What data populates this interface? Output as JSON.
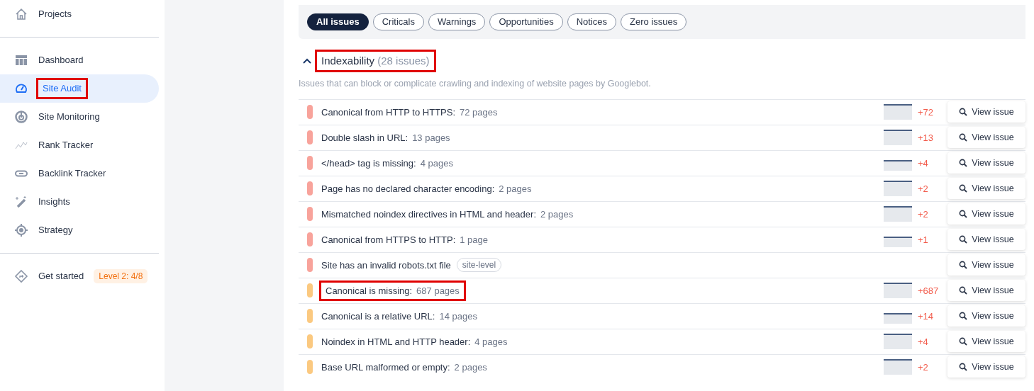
{
  "sidebar": {
    "top_items": [
      {
        "label": "Projects",
        "selected": false,
        "highlighted": false
      }
    ],
    "items": [
      {
        "label": "Dashboard",
        "selected": false,
        "highlighted": false
      },
      {
        "label": "Site Audit",
        "selected": true,
        "highlighted": true
      },
      {
        "label": "Site Monitoring",
        "selected": false,
        "highlighted": false
      },
      {
        "label": "Rank Tracker",
        "selected": false,
        "highlighted": false
      },
      {
        "label": "Backlink Tracker",
        "selected": false,
        "highlighted": false
      },
      {
        "label": "Insights",
        "selected": false,
        "highlighted": false
      },
      {
        "label": "Strategy",
        "selected": false,
        "highlighted": false
      }
    ],
    "bottom_items": [
      {
        "label": "Get started",
        "selected": false,
        "highlighted": false,
        "badge": "Level 2: 4/8"
      }
    ]
  },
  "filters": [
    {
      "label": "All issues",
      "selected": true
    },
    {
      "label": "Criticals",
      "selected": false
    },
    {
      "label": "Warnings",
      "selected": false
    },
    {
      "label": "Opportunities",
      "selected": false
    },
    {
      "label": "Notices",
      "selected": false
    },
    {
      "label": "Zero issues",
      "selected": false
    }
  ],
  "section": {
    "title": "Indexability",
    "count": "(28 issues)",
    "expanded": true,
    "highlighted": true,
    "description": "Issues that can block or complicate crawling and indexing of website pages by Googlebot.",
    "issues": [
      {
        "title": "Canonical from HTTP to HTTPS:",
        "pages": "72 pages",
        "color": "#f8a39b",
        "change": "+72",
        "button": "View issue",
        "highlighted": false
      },
      {
        "title": "Double slash in URL:",
        "pages": "13 pages",
        "color": "#f8a39b",
        "change": "+13",
        "button": "View issue",
        "highlighted": false
      },
      {
        "title": "</head> tag is missing:",
        "pages": "4 pages",
        "color": "#f8a39b",
        "change": "+4",
        "button": "View issue",
        "highlighted": false
      },
      {
        "title": "Page has no declared character encoding:",
        "pages": "2 pages",
        "color": "#f8a39b",
        "change": "+2",
        "button": "View issue",
        "highlighted": false
      },
      {
        "title": "Mismatched noindex directives in HTML and header:",
        "pages": "2 pages",
        "color": "#f8a39b",
        "change": "+2",
        "button": "View issue",
        "highlighted": false
      },
      {
        "title": "Canonical from HTTPS to HTTP:",
        "pages": "1 page",
        "color": "#f8a39b",
        "change": "+1",
        "button": "View issue",
        "highlighted": false
      },
      {
        "title": "Site has an invalid robots.txt file",
        "tag": "site-level",
        "color": "#f8a39b",
        "button": "View issue",
        "highlighted": false
      },
      {
        "title": "Canonical is missing:",
        "pages": "687 pages",
        "color": "#fbc980",
        "change": "+687",
        "button": "View issue",
        "highlighted": true
      },
      {
        "title": "Canonical is a relative URL:",
        "pages": "14 pages",
        "color": "#fbc980",
        "change": "+14",
        "button": "View issue",
        "highlighted": false
      },
      {
        "title": "Noindex in HTML and HTTP header:",
        "pages": "4 pages",
        "color": "#fbc980",
        "change": "+4",
        "button": "View issue",
        "highlighted": false
      },
      {
        "title": "Base URL malformed or empty:",
        "pages": "2 pages",
        "color": "#fbc980",
        "change": "+2",
        "button": "View issue",
        "highlighted": false
      }
    ]
  }
}
